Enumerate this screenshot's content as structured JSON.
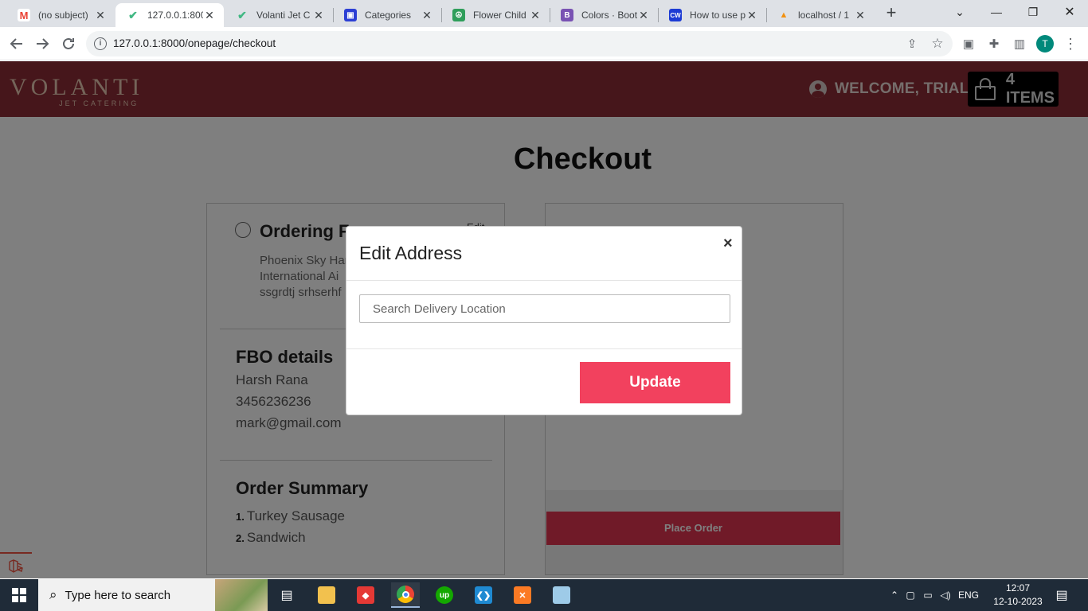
{
  "browser": {
    "tabs": [
      {
        "title": "(no subject)",
        "icon": "gmail-icon",
        "color": "#ea4335"
      },
      {
        "title": "127.0.0.1:800",
        "icon": "vue-icon",
        "color": "#41b883"
      },
      {
        "title": "Volanti Jet C",
        "icon": "vue-icon",
        "color": "#41b883"
      },
      {
        "title": "Categories",
        "icon": "bag-icon",
        "color": "#2c3fd4"
      },
      {
        "title": "Flower Child",
        "icon": "peace-icon",
        "color": "#2f9e5b"
      },
      {
        "title": "Colors · Boot",
        "icon": "bootstrap-icon",
        "color": "#7952b3"
      },
      {
        "title": "How to use p",
        "icon": "cw-icon",
        "color": "#1c3bd4"
      },
      {
        "title": "localhost / 1",
        "icon": "phpmyadmin-icon",
        "color": "#f29111"
      }
    ],
    "url": "127.0.0.1:8000/onepage/checkout",
    "profile_initial": "T"
  },
  "header": {
    "logo_main": "VOLANTI",
    "logo_sub": "JET CATERING",
    "welcome": "WELCOME, TRIAL",
    "cart": "4 ITEMS"
  },
  "checkout": {
    "title": "Checkout",
    "ordering": {
      "title": "Ordering F",
      "edit": "Edit",
      "address_lines": [
        "Phoenix Sky Har",
        "International Ai",
        "ssgrdtj srhserhf"
      ]
    },
    "fbo": {
      "title": "FBO details",
      "name": "Harsh Rana",
      "phone": "3456236236",
      "email": "mark@gmail.com"
    },
    "summary": {
      "title": "Order Summary",
      "items": [
        "Turkey Sausage",
        "Sandwich"
      ]
    },
    "place_order": "Place Order"
  },
  "modal": {
    "title": "Edit Address",
    "close": "×",
    "search_placeholder": "Search Delivery Location",
    "update": "Update"
  },
  "taskbar": {
    "search_placeholder": "Type here to search",
    "lang": "ENG",
    "time": "12:07",
    "date": "12-10-2023"
  },
  "colors": {
    "brand": "#8c2d36",
    "accent": "#f2415e"
  }
}
